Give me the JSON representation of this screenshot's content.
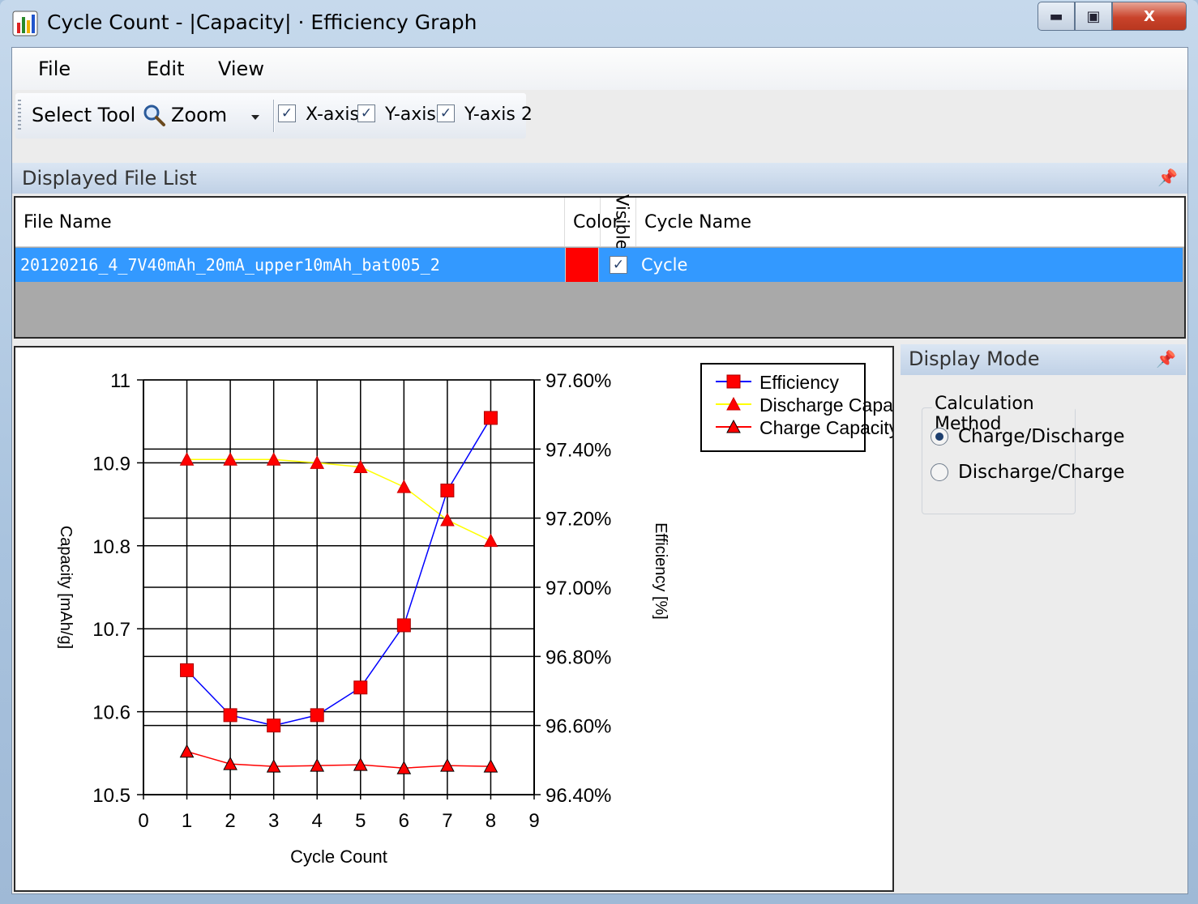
{
  "window": {
    "title": "Cycle Count - |Capacity| · Efficiency Graph",
    "buttons": {
      "minimize": "▬",
      "maximize": "▣",
      "close": "X"
    }
  },
  "menu": [
    "File",
    "Edit",
    "View"
  ],
  "toolbar": {
    "tool_select": "Select Tool",
    "zoom": "Zoom",
    "checks": [
      {
        "label": "X-axis",
        "checked": true
      },
      {
        "label": "Y-axis",
        "checked": true
      },
      {
        "label": "Y-axis 2",
        "checked": true
      }
    ]
  },
  "file_list": {
    "panel_title": "Displayed File List",
    "columns": {
      "file_name": "File Name",
      "color": "Color",
      "visible": "Visible",
      "cycle_name": "Cycle Name"
    },
    "rows": [
      {
        "file_name": "20120216_4_7V40mAh_20mA_upper10mAh_bat005_2",
        "color": "#ff0000",
        "visible": true,
        "cycle_name": "Cycle"
      }
    ]
  },
  "mode_panel": {
    "title": "Display Mode",
    "group_label": "Calculation Method",
    "options": [
      {
        "label": "Charge/Discharge",
        "selected": true
      },
      {
        "label": "Discharge/Charge",
        "selected": false
      }
    ]
  },
  "chart_data": {
    "type": "line",
    "xlabel": "Cycle Count",
    "ylabel": "Capacity [mAh/g]",
    "y2label": "Efficiency [%]",
    "xlim": [
      0,
      9
    ],
    "ylim": [
      10.5,
      11
    ],
    "y2lim": [
      96.4,
      97.6
    ],
    "x_ticks": [
      0,
      1,
      2,
      3,
      4,
      5,
      6,
      7,
      8,
      9
    ],
    "y_ticks": [
      "10.5",
      "10.6",
      "10.7",
      "10.8",
      "10.9",
      "11"
    ],
    "y2_ticks": [
      "96.40%",
      "96.60%",
      "96.80%",
      "97.00%",
      "97.20%",
      "97.40%",
      "97.60%"
    ],
    "grid": true,
    "legend": "top-right",
    "series": [
      {
        "name": "Efficiency",
        "axis": "y2",
        "color": "#0000ff",
        "marker": "square",
        "x": [
          1,
          2,
          3,
          4,
          5,
          6,
          7,
          8
        ],
        "values": [
          96.76,
          96.63,
          96.6,
          96.63,
          96.71,
          96.89,
          97.28,
          97.49
        ]
      },
      {
        "name": "Discharge Capacity",
        "axis": "y",
        "color": "#ffff00",
        "marker": "triangle",
        "x": [
          1,
          2,
          3,
          4,
          5,
          6,
          7,
          8
        ],
        "values": [
          10.904,
          10.904,
          10.904,
          10.9,
          10.895,
          10.871,
          10.831,
          10.806
        ]
      },
      {
        "name": "Charge Capacity",
        "axis": "y",
        "color": "#ff0000",
        "marker": "triangle",
        "x": [
          1,
          2,
          3,
          4,
          5,
          6,
          7,
          8
        ],
        "values": [
          10.552,
          10.537,
          10.534,
          10.535,
          10.536,
          10.532,
          10.535,
          10.534
        ]
      }
    ]
  }
}
